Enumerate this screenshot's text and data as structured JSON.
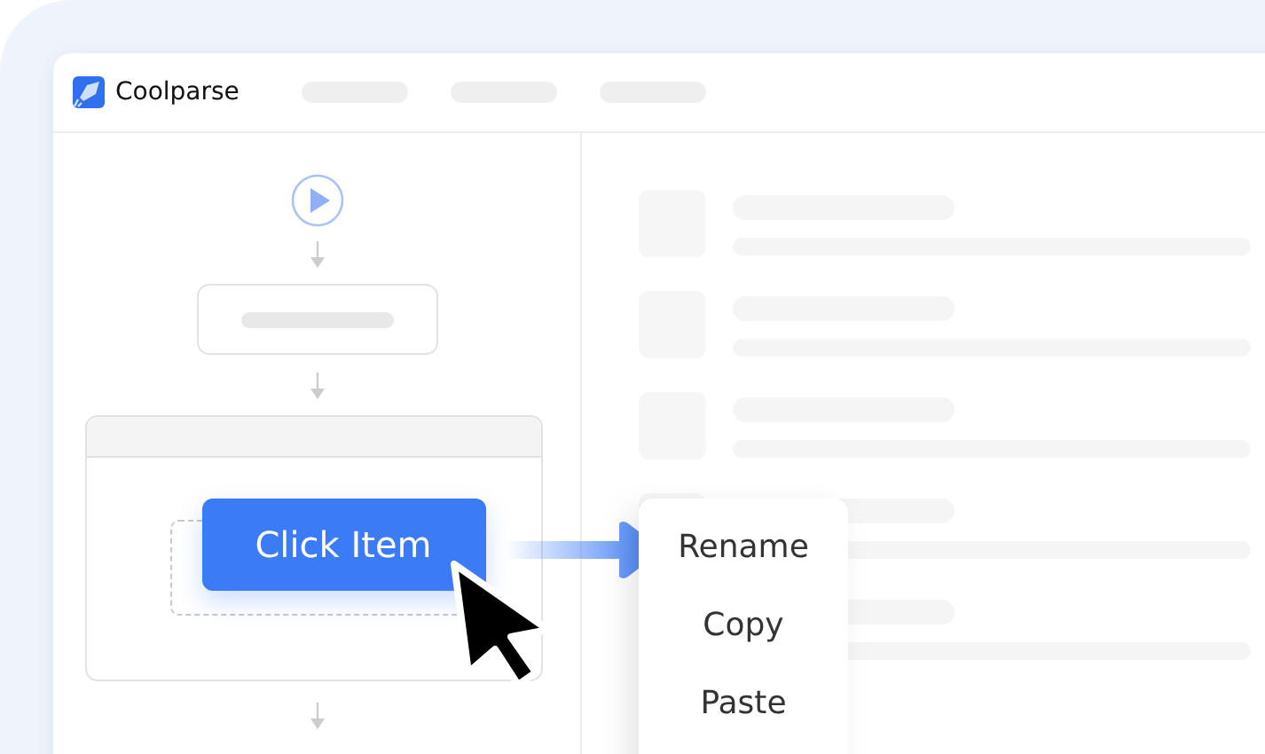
{
  "window": {
    "app_name": "Coolparse"
  },
  "flow": {
    "action_button": "Click Item"
  },
  "context_menu": {
    "items": [
      "Rename",
      "Copy",
      "Paste"
    ]
  }
}
